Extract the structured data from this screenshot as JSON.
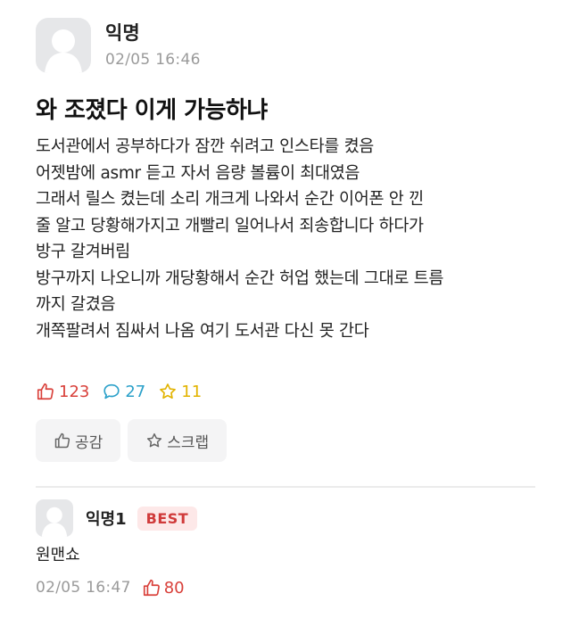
{
  "post": {
    "author": "익명",
    "time": "02/05 16:46",
    "title": "와 조졌다 이게 가능하냐",
    "body_lines": [
      "도서관에서 공부하다가 잠깐 쉬려고 인스타를 켰음",
      "어젯밤에 asmr 듣고 자서 음량 볼륨이 최대였음",
      "그래서 릴스 켰는데 소리 개크게 나와서 순간 이어폰 안 낀",
      "줄 알고 당황해가지고 개빨리 일어나서 죄송합니다 하다가",
      "방구 갈겨버림",
      "방구까지 나오니까 개당황해서 순간 허업 했는데 그대로 트름",
      "까지 갈겼음",
      "개쪽팔려서 짐싸서 나옴 여기 도서관 다신 못 간다"
    ],
    "stats": {
      "likes": "123",
      "comments": "27",
      "scraps": "11"
    },
    "actions": {
      "like_label": "공감",
      "scrap_label": "스크랩"
    }
  },
  "comment": {
    "author": "익명1",
    "badge": "BEST",
    "text": "원맨쇼",
    "time": "02/05 16:47",
    "likes": "80"
  },
  "icons": {
    "avatar": "user-avatar-icon",
    "like": "thumbs-up-icon",
    "comment": "speech-bubble-icon",
    "scrap": "star-icon"
  },
  "colors": {
    "like": "#d9403a",
    "comment": "#2aa0c9",
    "scrap": "#e2b300",
    "best_badge_bg": "#fde8e8",
    "best_badge_text": "#d03a3a"
  }
}
